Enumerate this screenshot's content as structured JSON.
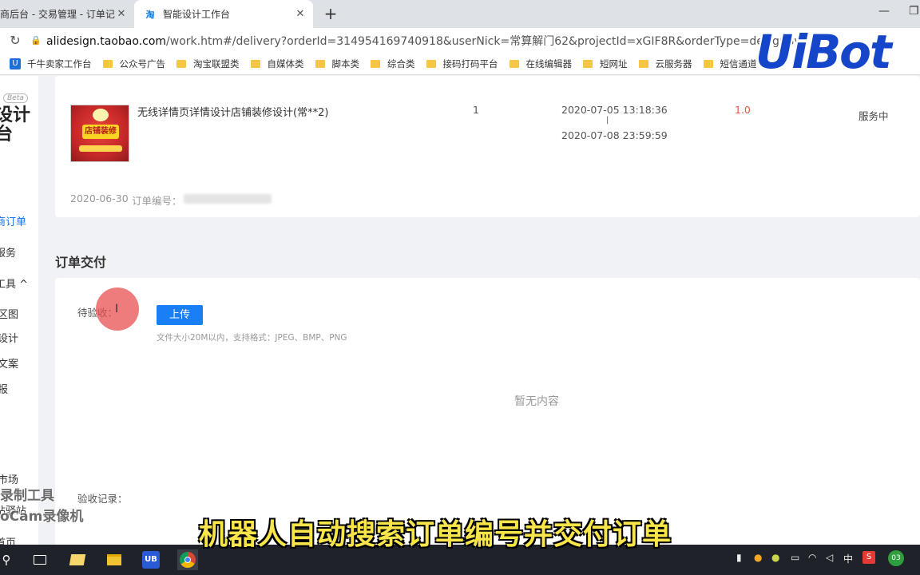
{
  "browser": {
    "tabs": [
      {
        "title": "商后台 - 交易管理 - 订单记录",
        "active": false
      },
      {
        "title": "智能设计工作台",
        "active": true,
        "favicon": "淘"
      }
    ],
    "url_host": "alidesign.taobao.com",
    "url_rest": "/work.htm#/delivery?orderId=314954169740918&userNick=常算解门62&projectId=xGIF8R&orderType=designByPiece&r...",
    "bookmarks": [
      {
        "label": "千牛卖家工作台",
        "type": "app"
      },
      {
        "label": "公众号广告",
        "type": "folder"
      },
      {
        "label": "淘宝联盟类",
        "type": "folder"
      },
      {
        "label": "自媒体类",
        "type": "folder"
      },
      {
        "label": "脚本类",
        "type": "folder"
      },
      {
        "label": "综合类",
        "type": "folder"
      },
      {
        "label": "接码打码平台",
        "type": "folder"
      },
      {
        "label": "在线编辑器",
        "type": "folder"
      },
      {
        "label": "短网址",
        "type": "folder"
      },
      {
        "label": "云服务器",
        "type": "folder"
      },
      {
        "label": "短信通道",
        "type": "folder"
      }
    ]
  },
  "sidebar": {
    "beta": "Beta",
    "logo_line1": "设计",
    "logo_line2": "台",
    "items": [
      {
        "label": "商订单",
        "active": true
      },
      {
        "label": "服务"
      },
      {
        "label": "工具  ^"
      },
      {
        "label": "区图"
      },
      {
        "label": "设计"
      },
      {
        "label": "文案"
      },
      {
        "label": "报"
      },
      {
        "label": "市场"
      },
      {
        "label": "站驿站"
      },
      {
        "label": "首页"
      }
    ]
  },
  "order": {
    "title": "无线详情页详情设计店铺装修设计(常**2)",
    "qty": "1",
    "start_time": "2020-07-05 13:18:36",
    "separator": "|",
    "end_time": "2020-07-08 23:59:59",
    "price": "1.0",
    "status": "服务中",
    "date": "2020-06-30",
    "order_no_label": "订单编号：",
    "thumb_badge": "店铺装修"
  },
  "delivery": {
    "section_title": "订单交付",
    "pending_label": "待验收：",
    "upload_label": "上传",
    "hint": "文件大小20M以内，支持格式：JPEG、BMP、PNG",
    "empty": "暂无内容",
    "record_label": "验收记录："
  },
  "overlay": {
    "watermark_line1": "录制工具",
    "watermark_line2": "oCam录像机",
    "subtitle": "机器人自动搜索订单编号并交付订单",
    "brand": "UiBot"
  },
  "taskbar": {
    "ime": "中",
    "badge": "03"
  },
  "colors": {
    "accent": "#1a7ef5",
    "price": "#e8553e",
    "subtitle": "#f7e54a",
    "brand": "#1546c9"
  }
}
